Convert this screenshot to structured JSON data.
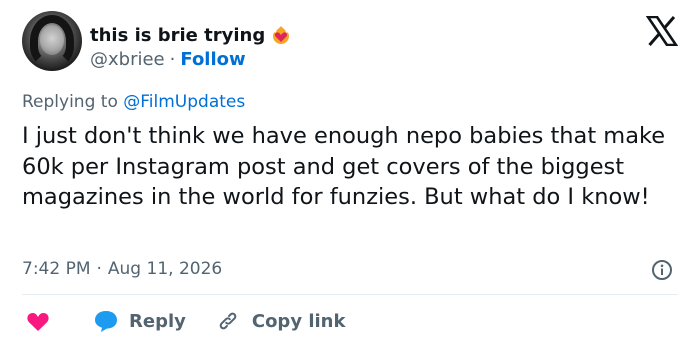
{
  "author": {
    "name": "this is brie trying",
    "handle": "@xbriee",
    "separator": "·",
    "follow_label": "Follow"
  },
  "reply_context": {
    "prefix": "Replying to",
    "mention": "@FilmUpdates"
  },
  "tweet": {
    "text": "I just don't think we have enough nepo babies that make 60k per Instagram post and get covers of the biggest magazines in the world for funzies. But what do I know!"
  },
  "meta": {
    "time": "7:42 PM",
    "separator": "·",
    "date": "Aug 11, 2026"
  },
  "actions": {
    "reply_label": "Reply",
    "copy_label": "Copy link"
  },
  "colors": {
    "text": "#0f1419",
    "secondary": "#536471",
    "link": "#006fd6",
    "like": "#f91880",
    "reply": "#1d9bf0"
  },
  "icons": [
    "flaming-heart-icon",
    "x-logo-icon",
    "info-icon",
    "heart-icon",
    "reply-bubble-icon",
    "link-icon"
  ]
}
